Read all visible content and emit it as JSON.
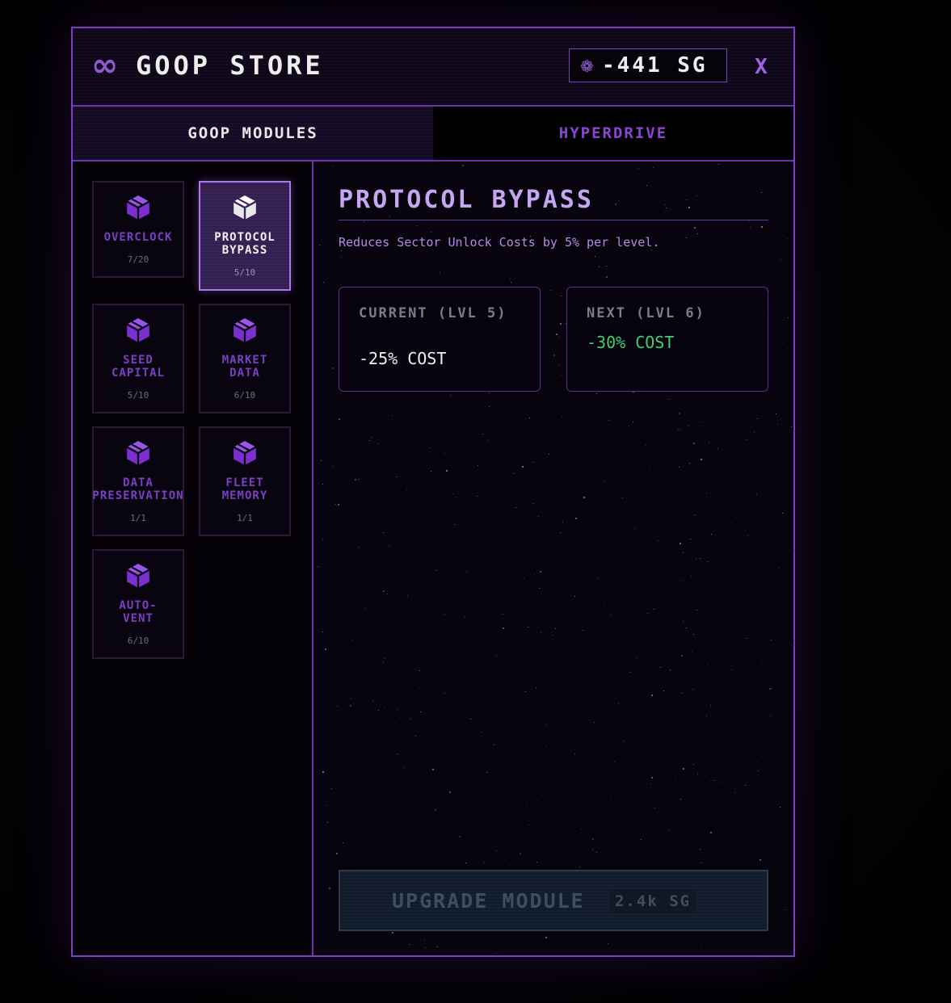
{
  "header": {
    "logo_icon": "∞",
    "title": "GOOP STORE",
    "currency_icon": "❁",
    "currency_value": "-441 SG",
    "close_label": "X"
  },
  "tabs": [
    {
      "label": "GOOP MODULES",
      "active": true
    },
    {
      "label": "HYPERDRIVE",
      "active": false
    }
  ],
  "modules": [
    {
      "name": "OVERCLOCK",
      "level": "7/20",
      "selected": false,
      "icon": "cube-icon"
    },
    {
      "name": "PROTOCOL\nBYPASS",
      "level": "5/10",
      "selected": true,
      "icon": "cube-icon"
    },
    {
      "name": "SEED\nCAPITAL",
      "level": "5/10",
      "selected": false,
      "icon": "cube-icon"
    },
    {
      "name": "MARKET\nDATA",
      "level": "6/10",
      "selected": false,
      "icon": "cube-icon"
    },
    {
      "name": "DATA\nPRESERVATION",
      "level": "1/1",
      "selected": false,
      "icon": "cube-icon"
    },
    {
      "name": "FLEET\nMEMORY",
      "level": "1/1",
      "selected": false,
      "icon": "cube-icon"
    },
    {
      "name": "AUTO-\nVENT",
      "level": "6/10",
      "selected": false,
      "icon": "cube-icon"
    }
  ],
  "detail": {
    "title": "PROTOCOL BYPASS",
    "description": "Reduces Sector Unlock Costs by 5% per level.",
    "current": {
      "label": "CURRENT (LVL 5)",
      "value": "-25% COST"
    },
    "next": {
      "label": "NEXT (LVL 6)",
      "value": "-30% COST"
    },
    "upgrade": {
      "label": "UPGRADE MODULE",
      "cost": "2.4k SG"
    }
  },
  "colors": {
    "accent": "#7b3fc0",
    "module_icon": "#7b2fd0",
    "next_value": "#3fcf6f",
    "current_value": "#f0f0f0"
  }
}
